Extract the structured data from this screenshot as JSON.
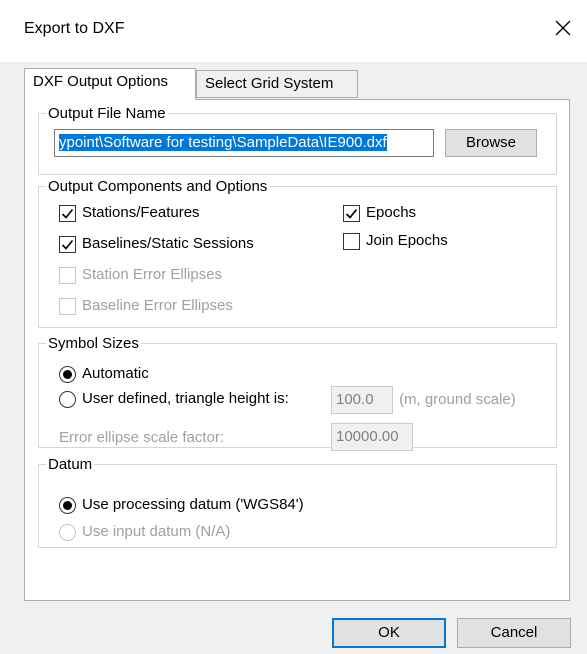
{
  "window": {
    "title": "Export to DXF"
  },
  "tabs": [
    {
      "label": "DXF Output Options"
    },
    {
      "label": "Select Grid System"
    }
  ],
  "output_file": {
    "legend": "Output File Name",
    "value": "ypoint\\Software for testing\\SampleData\\IE900.dxf",
    "browse_label": "Browse"
  },
  "components": {
    "legend": "Output Components and Options",
    "stations": {
      "label": "Stations/Features",
      "checked": true
    },
    "baselines": {
      "label": "Baselines/Static Sessions",
      "checked": true
    },
    "station_error": {
      "label": "Station Error Ellipses",
      "checked": false,
      "disabled": true
    },
    "baseline_error": {
      "label": "Baseline Error Ellipses",
      "checked": false,
      "disabled": true
    },
    "epochs": {
      "label": "Epochs",
      "checked": true
    },
    "join_epochs": {
      "label": "Join Epochs",
      "checked": false
    }
  },
  "symbol_sizes": {
    "legend": "Symbol Sizes",
    "automatic_label": "Automatic",
    "user_defined_label": "User defined, triangle height is:",
    "triangle_value": "100.0",
    "triangle_units": "(m, ground scale)",
    "error_scale_label": "Error ellipse scale factor:",
    "error_scale_value": "10000.00",
    "selected": "Automatic"
  },
  "datum": {
    "legend": "Datum",
    "processing_label": "Use processing datum ('WGS84')",
    "input_label": "Use input datum (N/A)",
    "selected": "processing"
  },
  "footer": {
    "ok_label": "OK",
    "cancel_label": "Cancel"
  }
}
